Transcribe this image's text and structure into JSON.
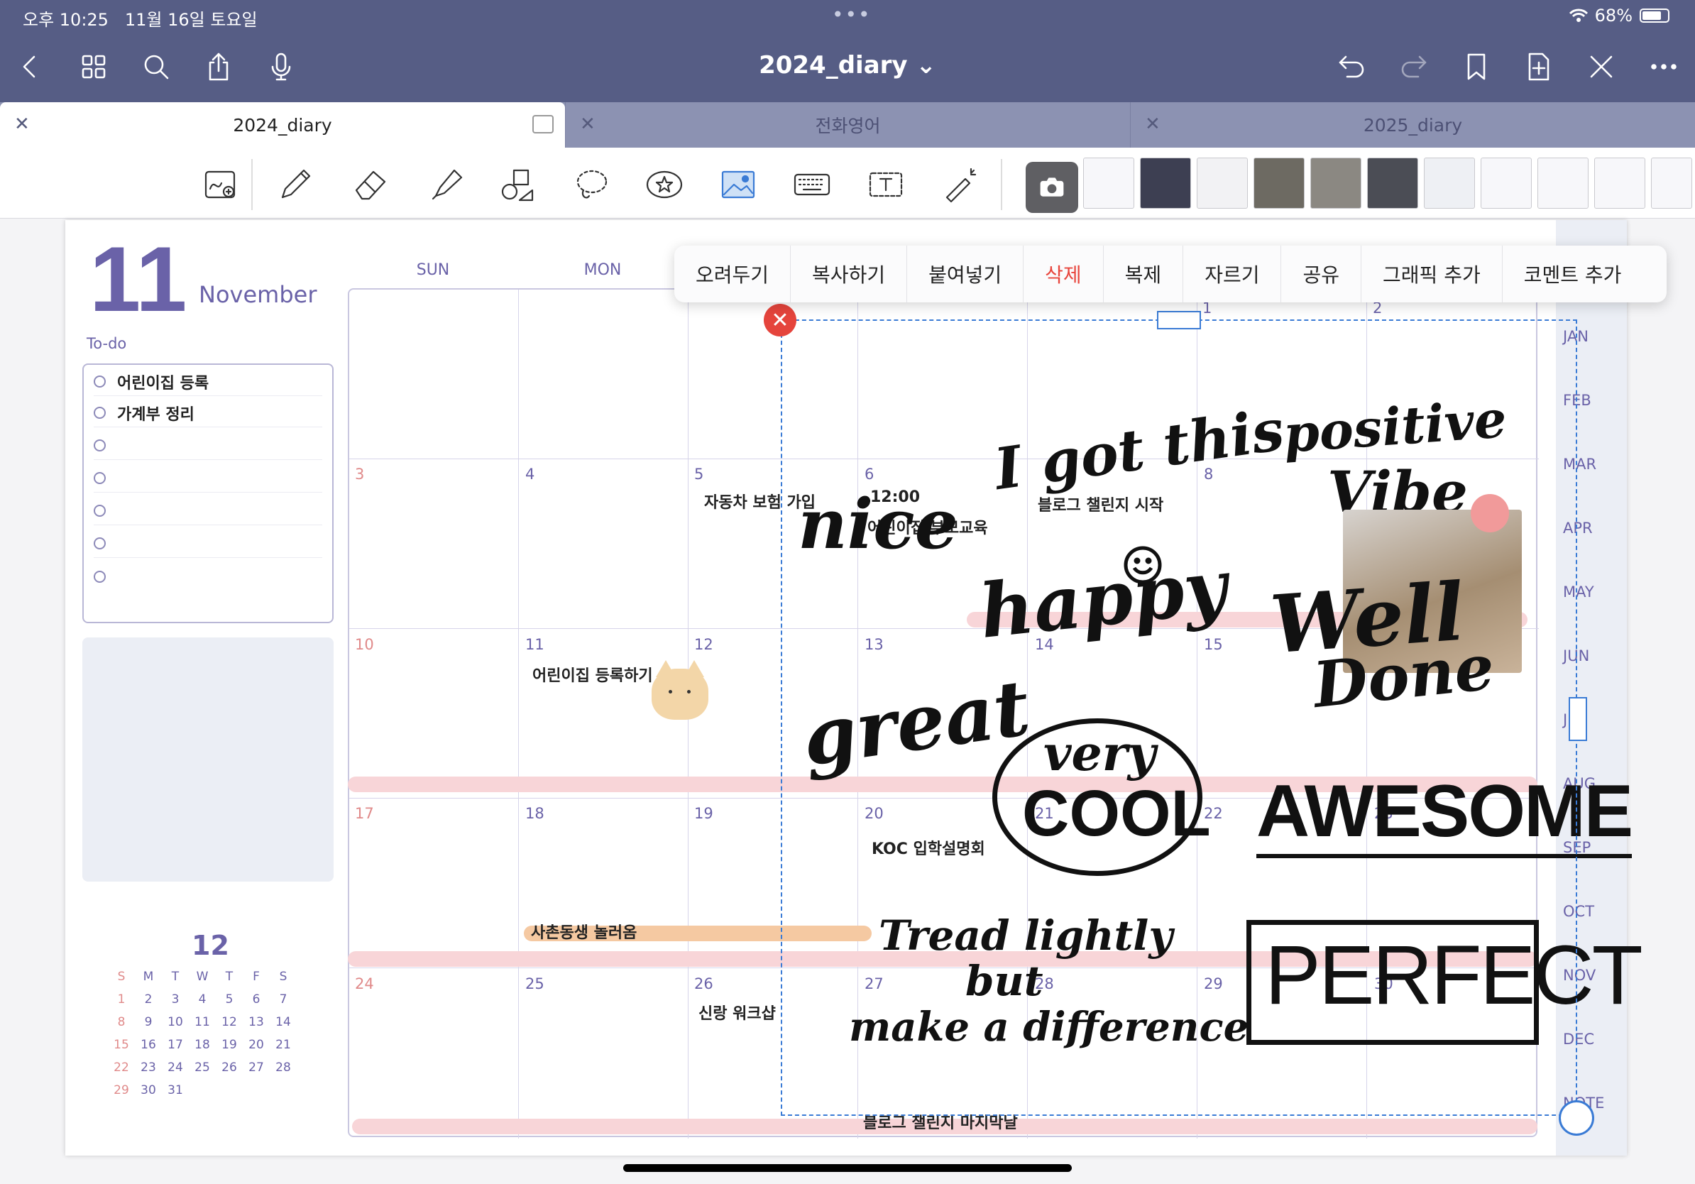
{
  "status": {
    "time": "오후 10:25",
    "date": "11월 16일 토요일",
    "battery": "68%"
  },
  "nav": {
    "title": "2024_diary ⌄"
  },
  "tabs": [
    {
      "label": "2024_diary"
    },
    {
      "label": "전화영어"
    },
    {
      "label": "2025_diary"
    }
  ],
  "planner": {
    "day": "11",
    "month": "November",
    "todo_label": "To-do",
    "todos": [
      "어린이집 등록",
      "가계부 정리",
      "",
      "",
      "",
      "",
      ""
    ],
    "days_of_week": [
      "SUN",
      "MON"
    ],
    "events": {
      "e5": "자동차 보험 가입",
      "e6_time": "12:00",
      "e6": "어린이집 부모교육",
      "e7": "블로그 챌린지 시작",
      "e11": "어린이집 등록하기",
      "e20": "KOC 입학설명회",
      "band18": "사촌동생 놀러옴",
      "e26": "신랑 워크샵",
      "band_last": "블로그 챌린지 마지막날"
    },
    "day_numbers": {
      "r1": [
        "1",
        "2"
      ],
      "r2": [
        "3",
        "4",
        "5",
        "6",
        "",
        "8"
      ],
      "r3": [
        "10",
        "11",
        "12",
        "13",
        "14",
        "15"
      ],
      "r4": [
        "17",
        "18",
        "19",
        "20",
        "21",
        "22",
        "23"
      ],
      "r5": [
        "24",
        "25",
        "26",
        "27",
        "28",
        "29",
        "30"
      ]
    },
    "months_tabs": [
      "JAN",
      "FEB",
      "MAR",
      "APR",
      "MAY",
      "JUN",
      "JUL",
      "AUG",
      "SEP",
      "OCT",
      "NOV",
      "DEC",
      "NOTE"
    ],
    "minical": {
      "title": "12",
      "head": [
        "S",
        "M",
        "T",
        "W",
        "T",
        "F",
        "S"
      ],
      "rows": [
        [
          "1",
          "2",
          "3",
          "4",
          "5",
          "6",
          "7"
        ],
        [
          "8",
          "9",
          "10",
          "11",
          "12",
          "13",
          "14"
        ],
        [
          "15",
          "16",
          "17",
          "18",
          "19",
          "20",
          "21"
        ],
        [
          "22",
          "23",
          "24",
          "25",
          "26",
          "27",
          "28"
        ],
        [
          "29",
          "30",
          "31",
          "",
          "",
          "",
          ""
        ]
      ]
    }
  },
  "context_menu": [
    "오려두기",
    "복사하기",
    "붙여넣기",
    "삭제",
    "복제",
    "자르기",
    "공유",
    "그래픽 추가",
    "코멘트 추가"
  ],
  "stickers": {
    "nice": "nice",
    "got_this": "I got this",
    "positive": "positive",
    "vibe": "Vibe",
    "happy": "happy",
    "well": "Well",
    "done": "Done",
    "great": "great",
    "very": "very",
    "cool": "COOL",
    "awesome": "AWESOME",
    "tread1": "Tread lightly",
    "tread2": "but",
    "tread3": "make a difference",
    "perfect": "PERFECT"
  },
  "colors": {
    "nav": "#565d85",
    "accent": "#6a62a8",
    "delete": "#e8453c",
    "selection": "#3a7bd5"
  }
}
